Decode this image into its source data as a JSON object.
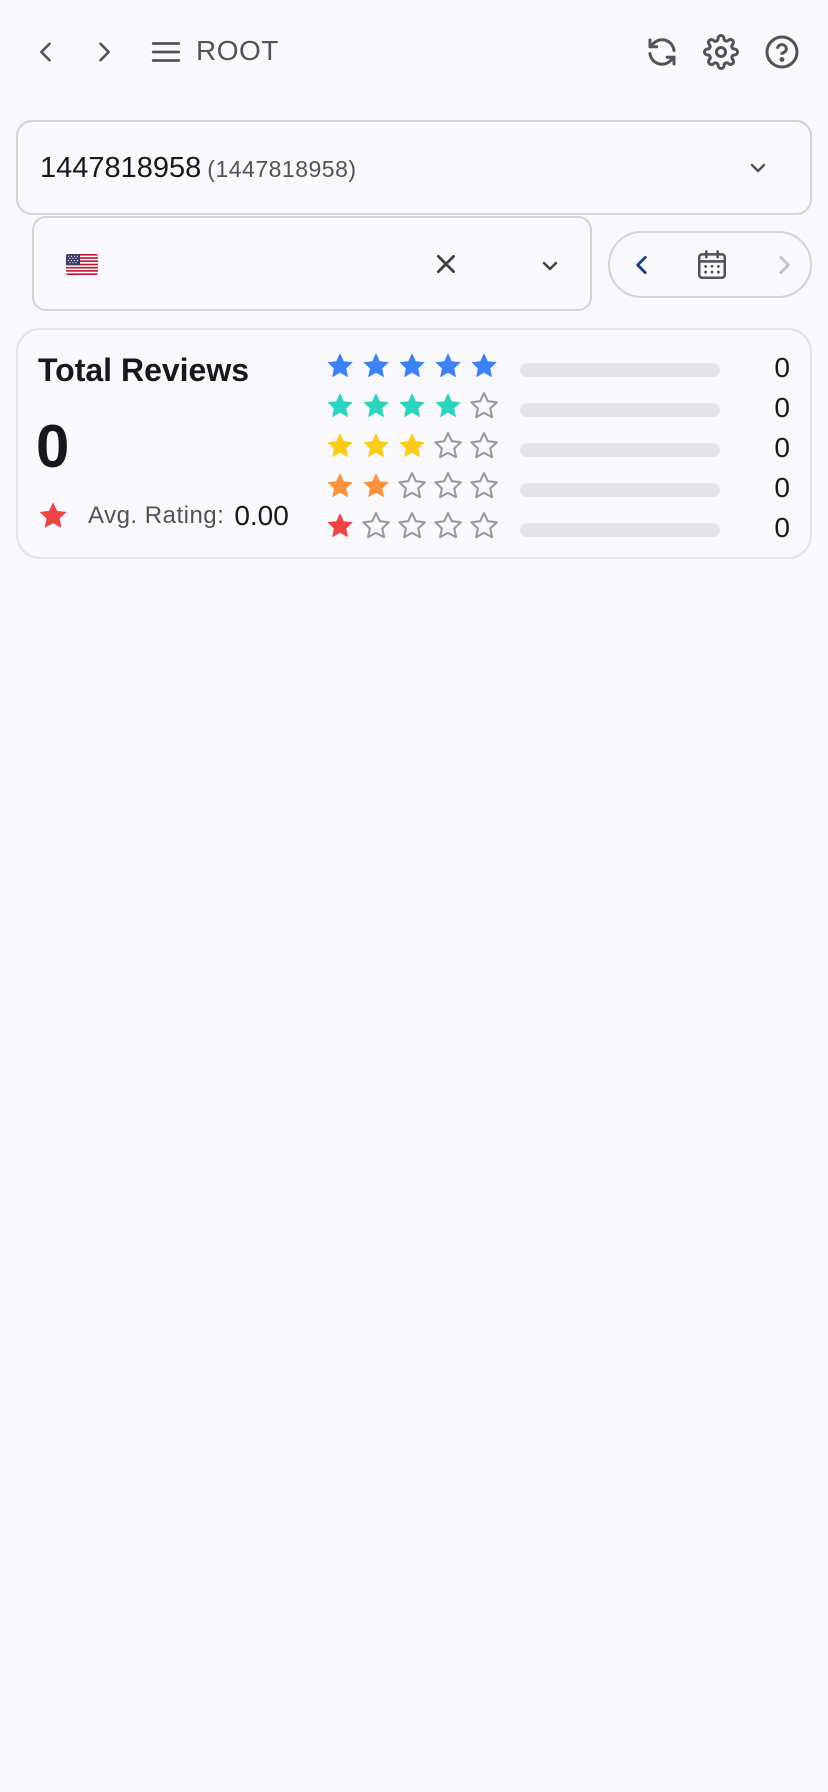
{
  "header": {
    "title": "ROOT",
    "back_icon": "chevron-left-icon",
    "forward_icon": "chevron-right-icon",
    "menu_icon": "hamburger-menu-icon",
    "refresh_icon": "refresh-icon",
    "settings_icon": "gear-icon",
    "help_icon": "help-circle-icon"
  },
  "app_selector": {
    "name": "1447818958",
    "id_text": "(1447818958)"
  },
  "country_selector": {
    "flag": "us-flag-icon"
  },
  "date_nav": {
    "icon": "calendar-icon"
  },
  "reviews": {
    "title": "Total Reviews",
    "total": "0",
    "avg_label": "Avg. Rating:",
    "avg_value": "0.00",
    "distribution": [
      {
        "stars": 5,
        "color": "#3b82f6",
        "count": "0",
        "fraction": 0
      },
      {
        "stars": 4,
        "color": "#2dd4bf",
        "count": "0",
        "fraction": 0
      },
      {
        "stars": 3,
        "color": "#facc15",
        "count": "0",
        "fraction": 0
      },
      {
        "stars": 2,
        "color": "#fb923c",
        "count": "0",
        "fraction": 0
      },
      {
        "stars": 1,
        "color": "#ef4444",
        "count": "0",
        "fraction": 0
      }
    ]
  },
  "colors": {
    "star_empty": "#9a9aa2",
    "avg_star": "#ef4444",
    "date_prev": "#1e3a8a",
    "date_next_disabled": "#c4c4cc"
  }
}
